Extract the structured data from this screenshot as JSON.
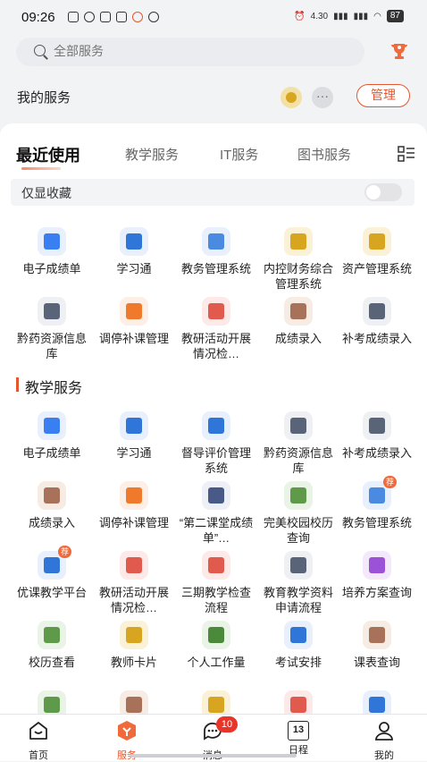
{
  "status": {
    "time": "09:26",
    "speed": "4.30",
    "battery": "87"
  },
  "search": {
    "placeholder": "全部服务"
  },
  "my_services": {
    "title": "我的服务",
    "more_label": "···",
    "manage_label": "管理"
  },
  "tabs": [
    "最近使用",
    "教学服务",
    "IT服务",
    "图书服务"
  ],
  "favorites_only": {
    "label": "仅显收藏",
    "on": false
  },
  "recent": [
    {
      "label": "电子成绩单",
      "icon": "report-card-icon",
      "bg": "#e8f0fd",
      "fg": "#3a7ff2"
    },
    {
      "label": "学习通",
      "icon": "video-learning-icon",
      "bg": "#e8f0fd",
      "fg": "#2f76d8"
    },
    {
      "label": "教务管理系统",
      "icon": "map-book-icon",
      "bg": "#e8f0fd",
      "fg": "#4a8ae0"
    },
    {
      "label": "内控财务综合管理系统",
      "icon": "finance-coin-icon",
      "bg": "#fbf1d6",
      "fg": "#d8a521"
    },
    {
      "label": "资产管理系统",
      "icon": "asset-coin-icon",
      "bg": "#fbf1d6",
      "fg": "#d8a521"
    },
    {
      "label": "黔药资源信息库",
      "icon": "binders-icon",
      "bg": "#eef0f4",
      "fg": "#5a6478"
    },
    {
      "label": "调停补课管理",
      "icon": "calendar-clock-icon",
      "bg": "#fdeee6",
      "fg": "#f07a2c"
    },
    {
      "label": "教研活动开展情况检…",
      "icon": "id-card-icon",
      "bg": "#fdeae8",
      "fg": "#e05a4e"
    },
    {
      "label": "成绩录入",
      "icon": "ledger-icon",
      "bg": "#f7ece4",
      "fg": "#a8715a"
    },
    {
      "label": "补考成绩录入",
      "icon": "edit-doc-icon",
      "bg": "#eef0f4",
      "fg": "#5a6478"
    }
  ],
  "teaching_section_title": "教学服务",
  "teaching": [
    {
      "label": "电子成绩单",
      "icon": "report-card-icon",
      "bg": "#e8f0fd",
      "fg": "#3a7ff2"
    },
    {
      "label": "学习通",
      "icon": "video-learning-icon",
      "bg": "#e8f0fd",
      "fg": "#2f76d8"
    },
    {
      "label": "督导评价管理系统",
      "icon": "paper-plane-icon",
      "bg": "#e8f0fd",
      "fg": "#2f76d8"
    },
    {
      "label": "黔药资源信息库",
      "icon": "binders-icon",
      "bg": "#eef0f4",
      "fg": "#5a6478"
    },
    {
      "label": "补考成绩录入",
      "icon": "edit-doc-icon",
      "bg": "#eef0f4",
      "fg": "#5a6478"
    },
    {
      "label": "成绩录入",
      "icon": "ledger-icon",
      "bg": "#f7ece4",
      "fg": "#a8715a"
    },
    {
      "label": "调停补课管理",
      "icon": "calendar-clock-icon",
      "bg": "#fdeee6",
      "fg": "#f07a2c"
    },
    {
      "label": "“第二课堂成绩单”…",
      "icon": "open-book-icon",
      "bg": "#eef0f7",
      "fg": "#4a5a88"
    },
    {
      "label": "完美校园校历查询",
      "icon": "calendar-grid-icon",
      "bg": "#e9f3e6",
      "fg": "#5f9a4a"
    },
    {
      "label": "教务管理系统",
      "icon": "map-book-icon",
      "bg": "#e8f0fd",
      "fg": "#4a8ae0",
      "badge": "荐"
    },
    {
      "label": "优课教学平台",
      "icon": "screen-play-icon",
      "bg": "#e8f0fd",
      "fg": "#2f76d8",
      "badge": "荐"
    },
    {
      "label": "教研活动开展情况检…",
      "icon": "id-card-icon",
      "bg": "#fdeae8",
      "fg": "#e05a4e"
    },
    {
      "label": "三期教学检查流程",
      "icon": "checklist-icon",
      "bg": "#fdeae8",
      "fg": "#e05a4e"
    },
    {
      "label": "教育教学资料申请流程",
      "icon": "money-doc-icon",
      "bg": "#eef0f4",
      "fg": "#5a6478"
    },
    {
      "label": "培养方案查询",
      "icon": "plan-d-icon",
      "bg": "#f3e9fb",
      "fg": "#9b52d6"
    },
    {
      "label": "校历查看",
      "icon": "calendar-grid-icon",
      "bg": "#e9f3e6",
      "fg": "#5f9a4a"
    },
    {
      "label": "教师卡片",
      "icon": "teacher-card-icon",
      "bg": "#fbf1d6",
      "fg": "#d8a521"
    },
    {
      "label": "个人工作量",
      "icon": "bar-chart-icon",
      "bg": "#e9f3e6",
      "fg": "#4a8a3a"
    },
    {
      "label": "考试安排",
      "icon": "monitor-100-icon",
      "bg": "#e8f0fd",
      "fg": "#2f76d8"
    },
    {
      "label": "课表查询",
      "icon": "house-schedule-icon",
      "bg": "#f7ece4",
      "fg": "#a8715a"
    },
    {
      "label": "",
      "icon": "calendar-grid-icon",
      "bg": "#e9f3e6",
      "fg": "#5f9a4a"
    },
    {
      "label": "",
      "icon": "ledger-icon",
      "bg": "#f7ece4",
      "fg": "#a8715a"
    },
    {
      "label": "",
      "icon": "form-doc-icon",
      "bg": "#fbf1d6",
      "fg": "#d8a521"
    },
    {
      "label": "",
      "icon": "certificate-icon",
      "bg": "#fdeae8",
      "fg": "#e05a4e"
    },
    {
      "label": "",
      "icon": "ab-card-icon",
      "bg": "#e8f0fd",
      "fg": "#2f76d8"
    }
  ],
  "tabbar": [
    {
      "label": "首页",
      "icon": "home-icon",
      "active": false
    },
    {
      "label": "服务",
      "icon": "services-icon",
      "active": true
    },
    {
      "label": "消息",
      "icon": "message-icon",
      "active": false,
      "badge": "10"
    },
    {
      "label": "日程",
      "icon": "calendar-icon",
      "active": false,
      "day": "13"
    },
    {
      "label": "我的",
      "icon": "profile-icon",
      "active": false
    }
  ],
  "colors": {
    "accent": "#e4572e",
    "badge_red": "#e9342a"
  }
}
